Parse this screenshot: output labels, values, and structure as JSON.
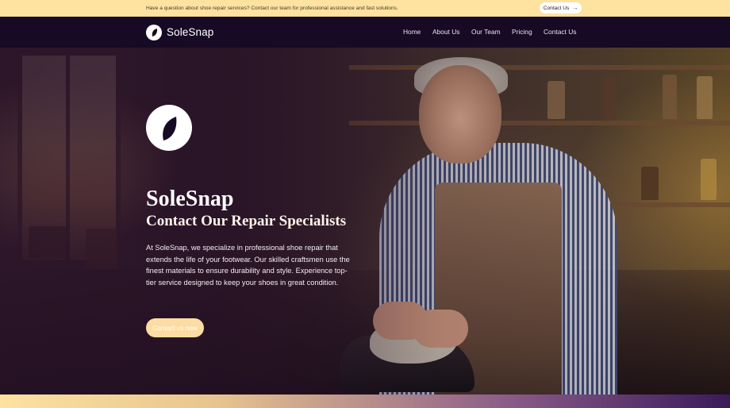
{
  "topbar": {
    "message": "Have a question about shoe repair services? Contact our team for professional assistance and fast solutions.",
    "button_label": "Contact Us",
    "button_icon": "arrow-right-icon"
  },
  "nav": {
    "brand": "SoleSnap",
    "brand_icon": "leaf-logo-icon",
    "links": [
      "Home",
      "About Us",
      "Our Team",
      "Pricing",
      "Contact Us"
    ]
  },
  "hero": {
    "logo_icon": "leaf-logo-icon",
    "title": "SoleSnap",
    "subtitle": "Contact Our Repair Specialists",
    "body": "At SoleSnap, we specialize in professional shoe repair that extends the life of your footwear. Our skilled craftsmen use the finest materials to ensure durability and style. Experience top-tier service designed to keep your shoes in great condition.",
    "cta_label": "Contact us now",
    "background_image": "craftsman repairing shoe in workshop"
  },
  "colors": {
    "topbar_bg": "#fde2a0",
    "navbar_bg": "#170a24",
    "accent": "#fcdca3",
    "text_light": "#ffffff"
  }
}
